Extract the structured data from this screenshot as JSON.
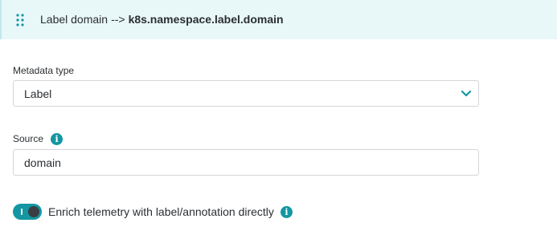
{
  "header": {
    "title_prefix": "Label domain",
    "arrow": "-->",
    "title_target": "k8s.namespace.label.domain",
    "handle_icon": "drag-handle-icon"
  },
  "metadata_type": {
    "label": "Metadata type",
    "selected": "Label",
    "chevron_icon": "chevron-down-icon"
  },
  "source": {
    "label": "Source",
    "value": "domain",
    "info_icon": "info-icon"
  },
  "enrich": {
    "label": "Enrich telemetry with label/annotation directly",
    "enabled": true,
    "info_icon": "info-icon"
  },
  "colors": {
    "accent": "#1496a3",
    "header_bg": "#e8f7f8",
    "text": "#2b2f33",
    "border": "#d4d6d9"
  }
}
